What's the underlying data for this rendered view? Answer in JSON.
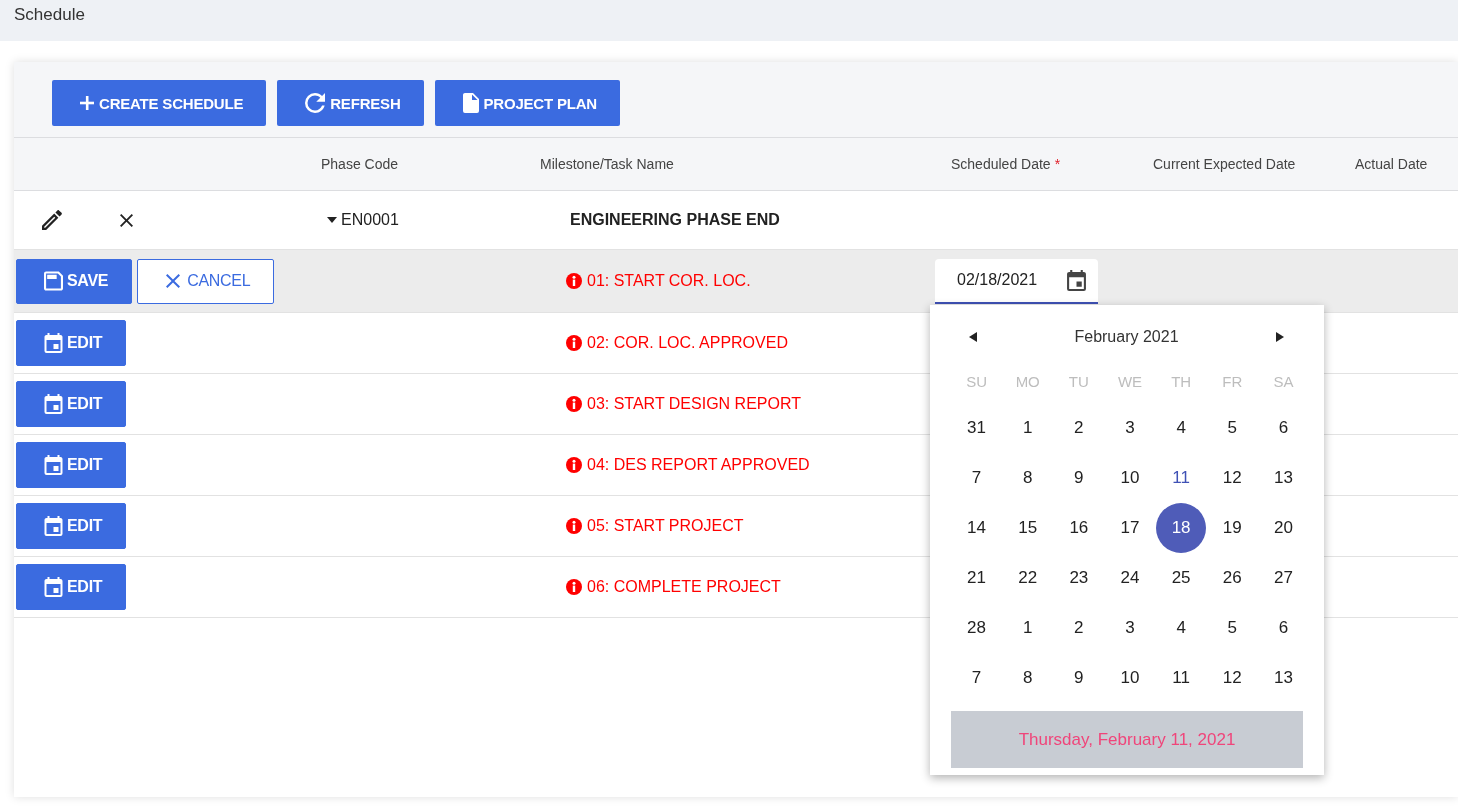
{
  "page_title": "Schedule",
  "toolbar": [
    {
      "kind": "create",
      "label": "CREATE SCHEDULE"
    },
    {
      "kind": "refresh",
      "label": "REFRESH"
    },
    {
      "kind": "plan",
      "label": "PROJECT PLAN"
    }
  ],
  "table": {
    "columns": [
      {
        "label": "Phase Code"
      },
      {
        "label": "Milestone/Task Name"
      },
      {
        "label": "Scheduled Date",
        "required_mark": "*"
      },
      {
        "label": "Current Expected Date"
      },
      {
        "label": "Actual Date"
      }
    ],
    "rows": [
      {
        "code": "EN0001",
        "name": "ENGINEERING PHASE END",
        "expanded": true,
        "children": [
          {
            "name": "01: START COR. LOC.",
            "warning": true,
            "editing": true,
            "actions": [
              {
                "kind": "save",
                "label": "SAVE"
              },
              {
                "kind": "cancel",
                "label": "CANCEL"
              }
            ],
            "scheduled_date": "02/18/2021",
            "date_picker": {
              "month_label": "February 2021",
              "weekdays": [
                "SU",
                "MO",
                "TU",
                "WE",
                "TH",
                "FR",
                "SA"
              ],
              "weeks": [
                [
                  {
                    "day": "31",
                    "selected": false,
                    "today": false
                  },
                  {
                    "day": "1",
                    "selected": false,
                    "today": false
                  },
                  {
                    "day": "2",
                    "selected": false,
                    "today": false
                  },
                  {
                    "day": "3",
                    "selected": false,
                    "today": false
                  },
                  {
                    "day": "4",
                    "selected": false,
                    "today": false
                  },
                  {
                    "day": "5",
                    "selected": false,
                    "today": false
                  },
                  {
                    "day": "6",
                    "selected": false,
                    "today": false
                  }
                ],
                [
                  {
                    "day": "7",
                    "selected": false,
                    "today": false
                  },
                  {
                    "day": "8",
                    "selected": false,
                    "today": false
                  },
                  {
                    "day": "9",
                    "selected": false,
                    "today": false
                  },
                  {
                    "day": "10",
                    "selected": false,
                    "today": false
                  },
                  {
                    "day": "11",
                    "selected": false,
                    "today": true
                  },
                  {
                    "day": "12",
                    "selected": false,
                    "today": false
                  },
                  {
                    "day": "13",
                    "selected": false,
                    "today": false
                  }
                ],
                [
                  {
                    "day": "14",
                    "selected": false,
                    "today": false
                  },
                  {
                    "day": "15",
                    "selected": false,
                    "today": false
                  },
                  {
                    "day": "16",
                    "selected": false,
                    "today": false
                  },
                  {
                    "day": "17",
                    "selected": false,
                    "today": false
                  },
                  {
                    "day": "18",
                    "selected": true,
                    "today": false
                  },
                  {
                    "day": "19",
                    "selected": false,
                    "today": false
                  },
                  {
                    "day": "20",
                    "selected": false,
                    "today": false
                  }
                ],
                [
                  {
                    "day": "21",
                    "selected": false,
                    "today": false
                  },
                  {
                    "day": "22",
                    "selected": false,
                    "today": false
                  },
                  {
                    "day": "23",
                    "selected": false,
                    "today": false
                  },
                  {
                    "day": "24",
                    "selected": false,
                    "today": false
                  },
                  {
                    "day": "25",
                    "selected": false,
                    "today": false
                  },
                  {
                    "day": "26",
                    "selected": false,
                    "today": false
                  },
                  {
                    "day": "27",
                    "selected": false,
                    "today": false
                  }
                ],
                [
                  {
                    "day": "28",
                    "selected": false,
                    "today": false
                  },
                  {
                    "day": "1",
                    "selected": false,
                    "today": false
                  },
                  {
                    "day": "2",
                    "selected": false,
                    "today": false
                  },
                  {
                    "day": "3",
                    "selected": false,
                    "today": false
                  },
                  {
                    "day": "4",
                    "selected": false,
                    "today": false
                  },
                  {
                    "day": "5",
                    "selected": false,
                    "today": false
                  },
                  {
                    "day": "6",
                    "selected": false,
                    "today": false
                  }
                ],
                [
                  {
                    "day": "7",
                    "selected": false,
                    "today": false
                  },
                  {
                    "day": "8",
                    "selected": false,
                    "today": false
                  },
                  {
                    "day": "9",
                    "selected": false,
                    "today": false
                  },
                  {
                    "day": "10",
                    "selected": false,
                    "today": false
                  },
                  {
                    "day": "11",
                    "selected": false,
                    "today": false
                  },
                  {
                    "day": "12",
                    "selected": false,
                    "today": false
                  },
                  {
                    "day": "13",
                    "selected": false,
                    "today": false
                  }
                ]
              ],
              "footer": "Thursday, February 11, 2021"
            }
          },
          {
            "name": "02: COR. LOC. APPROVED",
            "warning": true,
            "editing": false,
            "actions": [
              {
                "kind": "edit",
                "label": "EDIT"
              }
            ]
          },
          {
            "name": "03: START DESIGN REPORT",
            "warning": true,
            "editing": false,
            "actions": [
              {
                "kind": "edit",
                "label": "EDIT"
              }
            ]
          },
          {
            "name": "04: DES REPORT APPROVED",
            "warning": true,
            "editing": false,
            "actions": [
              {
                "kind": "edit",
                "label": "EDIT"
              }
            ]
          },
          {
            "name": "05: START PROJECT",
            "warning": true,
            "editing": false,
            "actions": [
              {
                "kind": "edit",
                "label": "EDIT"
              }
            ]
          },
          {
            "name": "06: COMPLETE PROJECT",
            "warning": true,
            "editing": false,
            "actions": [
              {
                "kind": "edit",
                "label": "EDIT"
              }
            ]
          }
        ]
      }
    ]
  }
}
